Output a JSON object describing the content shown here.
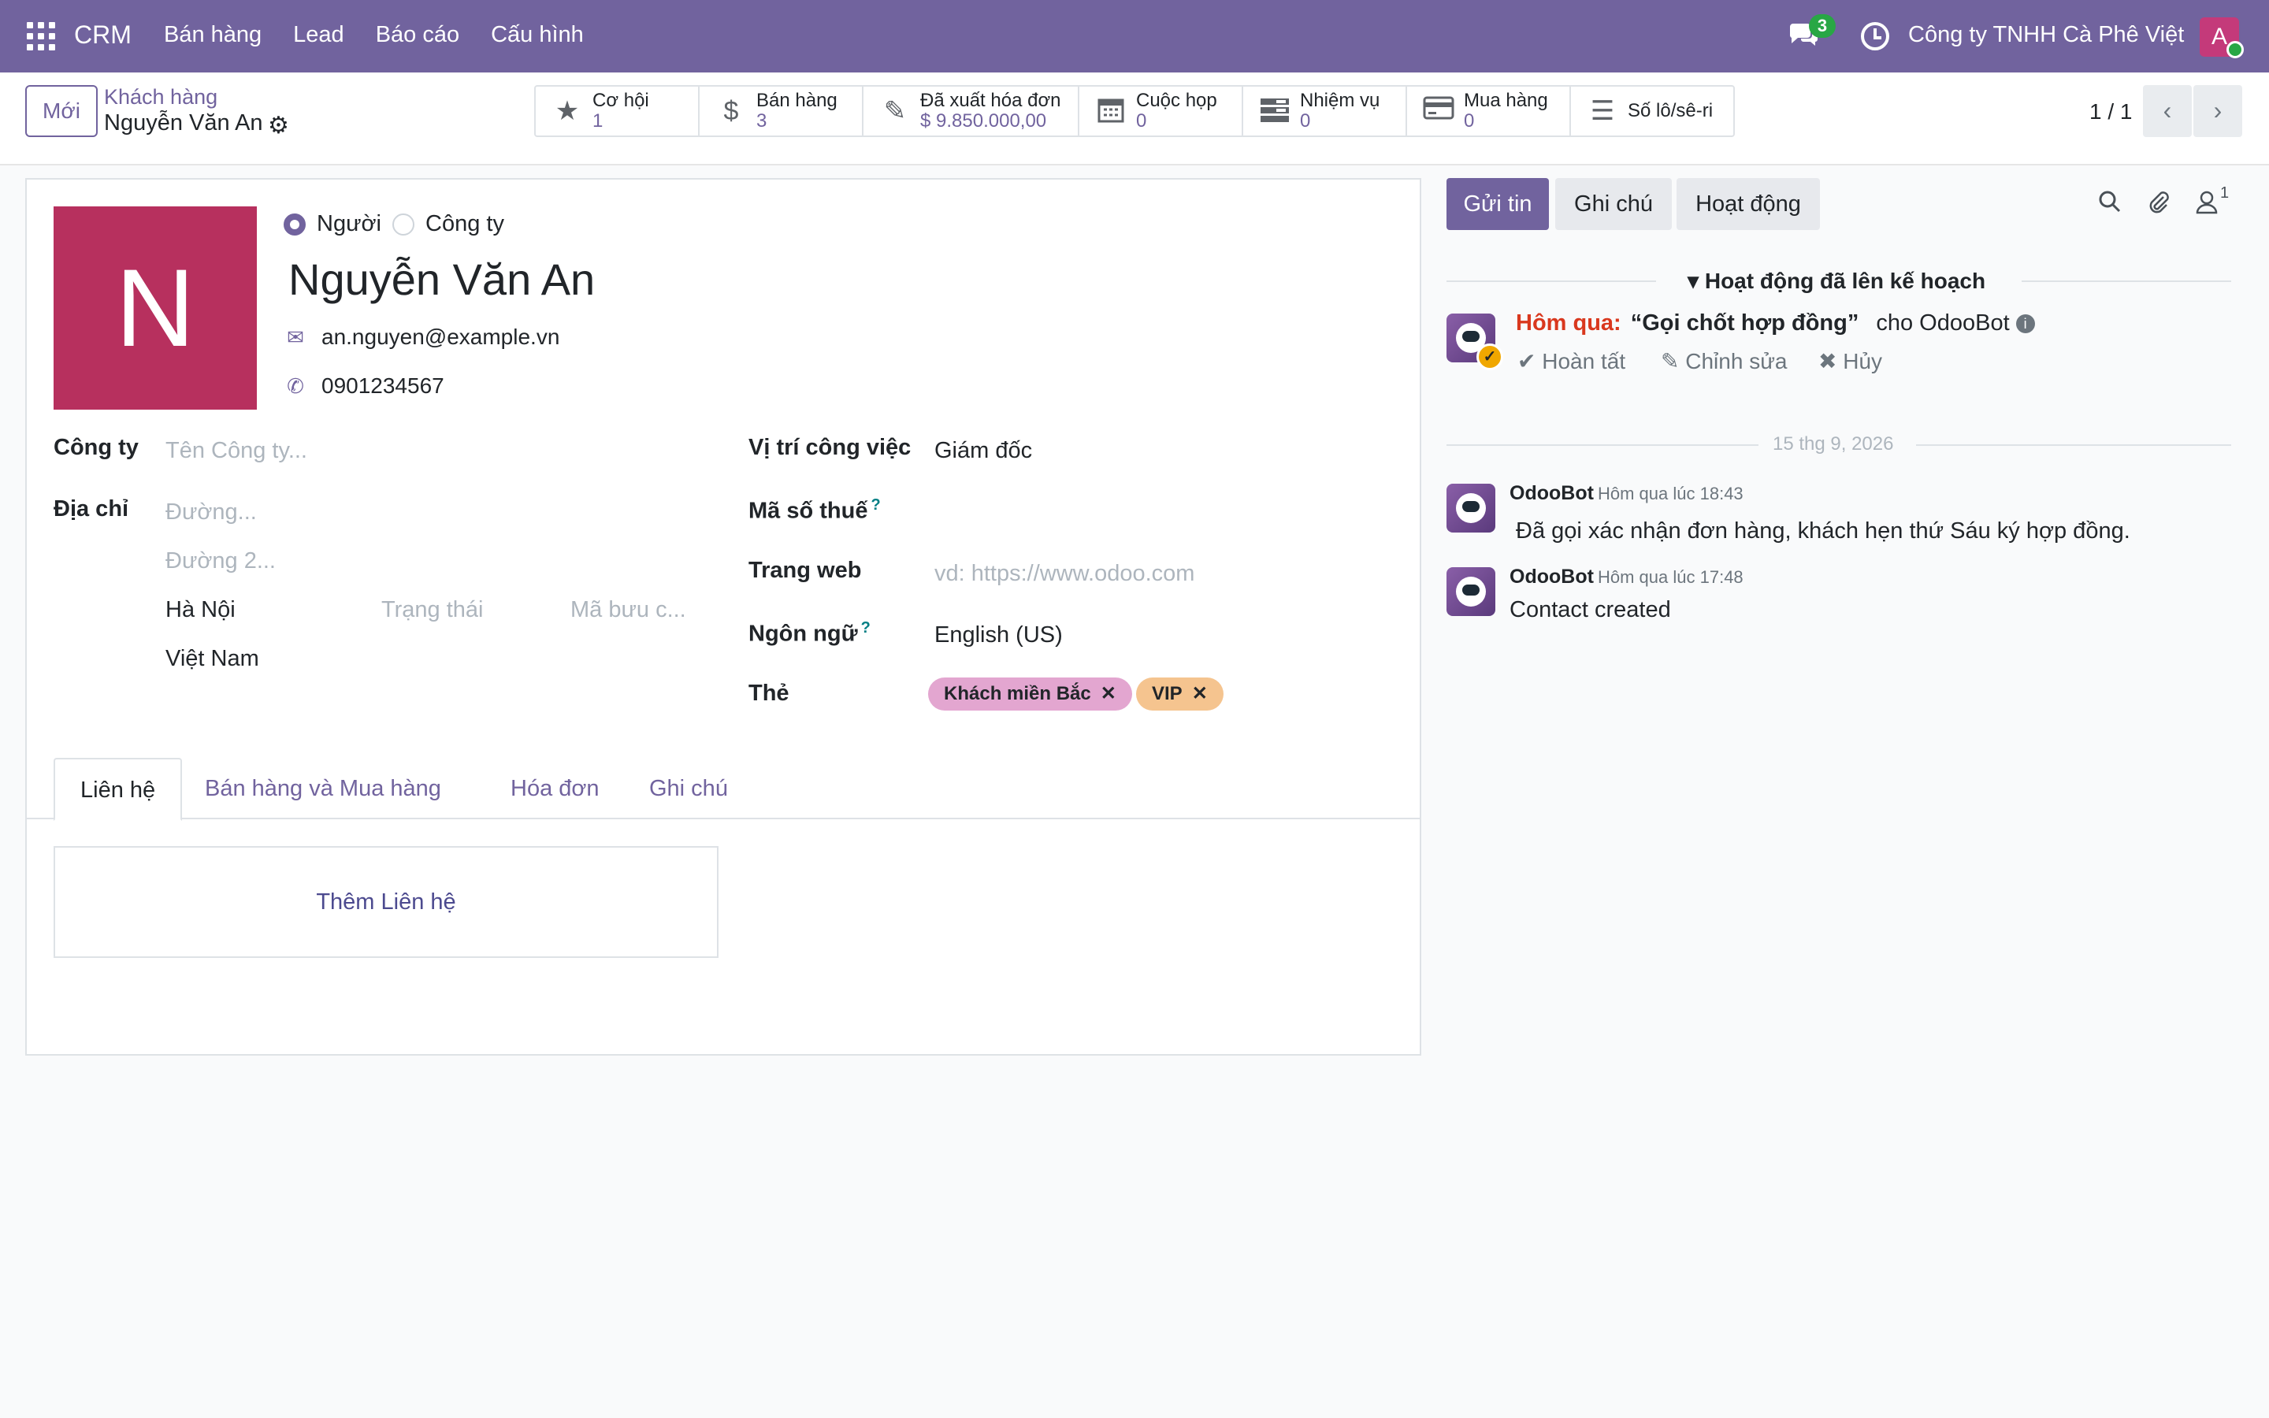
{
  "navbar": {
    "brand": "CRM",
    "menu": [
      "Bán hàng",
      "Lead",
      "Báo cáo",
      "Cấu hình"
    ],
    "chat_count": "3",
    "company": "Công ty TNHH Cà Phê Việt",
    "user_initial": "A",
    "colors": {
      "bar": "#71639e",
      "badge": "#28a745",
      "avatar": "#c43a7a"
    }
  },
  "control": {
    "new_label": "Mới",
    "breadcrumb_parent": "Khách hàng",
    "breadcrumb_current": "Nguyễn Văn An",
    "stats": [
      {
        "icon": "star-icon",
        "label": "Cơ hội",
        "value": "1"
      },
      {
        "icon": "dollar-icon",
        "label": "Bán hàng",
        "value": "3"
      },
      {
        "icon": "pencil-square-icon",
        "label": "Đã xuất hóa đơn",
        "value": "$ 9.850.000,00"
      },
      {
        "icon": "calendar-icon",
        "label": "Cuộc họp",
        "value": "0"
      },
      {
        "icon": "tasks-icon",
        "label": "Nhiệm vụ",
        "value": "0"
      },
      {
        "icon": "credit-card-icon",
        "label": "Mua hàng",
        "value": "0"
      },
      {
        "icon": "list-icon",
        "label": "Số lô/sê-ri",
        "value": ""
      }
    ],
    "pager": "1 / 1"
  },
  "form": {
    "avatar_letter": "N",
    "type_options": [
      "Người",
      "Công ty"
    ],
    "type_selected": "Người",
    "name": "Nguyễn Văn An",
    "email": "an.nguyen@example.vn",
    "phone": "0901234567",
    "labels": {
      "company": "Công ty",
      "address": "Địa chỉ",
      "job": "Vị trí công việc",
      "vat": "Mã số thuế",
      "website": "Trang web",
      "language": "Ngôn ngữ",
      "tags": "Thẻ"
    },
    "placeholders": {
      "company": "Tên Công ty...",
      "street": "Đường...",
      "street2": "Đường 2...",
      "state": "Trạng thái",
      "zip": "Mã bưu c...",
      "website": "vd: https://www.odoo.com"
    },
    "values": {
      "city": "Hà Nội",
      "country": "Việt Nam",
      "job": "Giám đốc",
      "language": "English (US)"
    },
    "tooltip_mark": "?",
    "tags": [
      {
        "label": "Khách miền Bắc",
        "color": "#e3a6d0"
      },
      {
        "label": "VIP",
        "color": "#f5c48f"
      }
    ],
    "tabs": [
      "Liên hệ",
      "Bán hàng và Mua hàng",
      "Hóa đơn",
      "Ghi chú"
    ],
    "add_contact": "Thêm Liên hệ"
  },
  "chatter": {
    "buttons": [
      "Gửi tin",
      "Ghi chú",
      "Hoạt động"
    ],
    "follower_count": "1",
    "planned_title": "Hoạt động đã lên kế hoạch",
    "activity": {
      "when": "Hôm qua:",
      "summary": "“Gọi chốt hợp đồng”",
      "for": "cho OdooBot",
      "actions": [
        "Hoàn tất",
        "Chỉnh sửa",
        "Hủy"
      ]
    },
    "date_separator": "15 thg 9, 2026",
    "messages": [
      {
        "author": "OdooBot",
        "date": "Hôm qua lúc 18:43",
        "body": "Đã gọi xác nhận đơn hàng, khách hẹn thứ Sáu ký hợp đồng."
      },
      {
        "author": "OdooBot",
        "date": "Hôm qua lúc 17:48",
        "body": "Contact created"
      }
    ]
  }
}
